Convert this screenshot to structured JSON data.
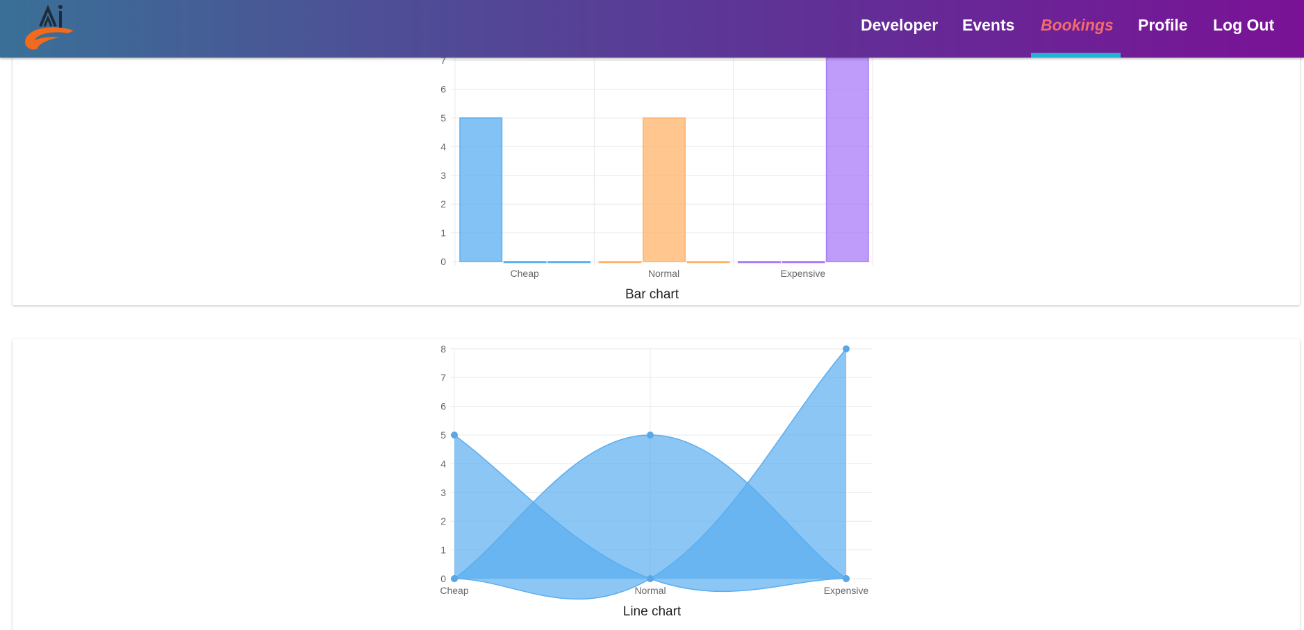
{
  "app": {
    "logo_name": "logo",
    "nav": [
      {
        "label": "Developer",
        "active": false
      },
      {
        "label": "Events",
        "active": false
      },
      {
        "label": "Bookings",
        "active": true
      },
      {
        "label": "Profile",
        "active": false
      },
      {
        "label": "Log Out",
        "active": false
      }
    ],
    "colors": {
      "nav_gradient_start": "#3a7097",
      "nav_gradient_end": "#7a1296",
      "active_nav_text": "#f36b6b",
      "active_underline": "#22b3d2"
    }
  },
  "chart_data": [
    {
      "type": "bar",
      "title": "Bar chart",
      "categories": [
        "Cheap",
        "Normal",
        "Expensive"
      ],
      "series": [
        {
          "values": [
            5,
            0,
            0
          ],
          "color": "#5aaef0"
        },
        {
          "values": [
            0,
            5,
            0
          ],
          "color": "#ffb36b"
        },
        {
          "values": [
            0,
            0,
            8
          ],
          "color": "#a97af8"
        }
      ],
      "series_colors_by_index": [
        "#5aaef0",
        "#ffb36b",
        "#a97af8"
      ],
      "yticks": [
        0,
        1,
        2,
        3,
        4,
        5,
        6,
        7
      ],
      "ylim": [
        0,
        8
      ],
      "grid": true
    },
    {
      "type": "area",
      "title": "Line chart",
      "categories": [
        "Cheap",
        "Normal",
        "Expensive"
      ],
      "series": [
        {
          "values": [
            5,
            0,
            0
          ],
          "color": "#5aaef0"
        },
        {
          "values": [
            0,
            5,
            0
          ],
          "color": "#5aaef0"
        },
        {
          "values": [
            0,
            0,
            8
          ],
          "color": "#5aaef0"
        }
      ],
      "yticks": [
        0,
        1,
        2,
        3,
        4,
        5,
        6,
        7,
        8
      ],
      "ylim": [
        0,
        8
      ],
      "grid": true
    }
  ]
}
